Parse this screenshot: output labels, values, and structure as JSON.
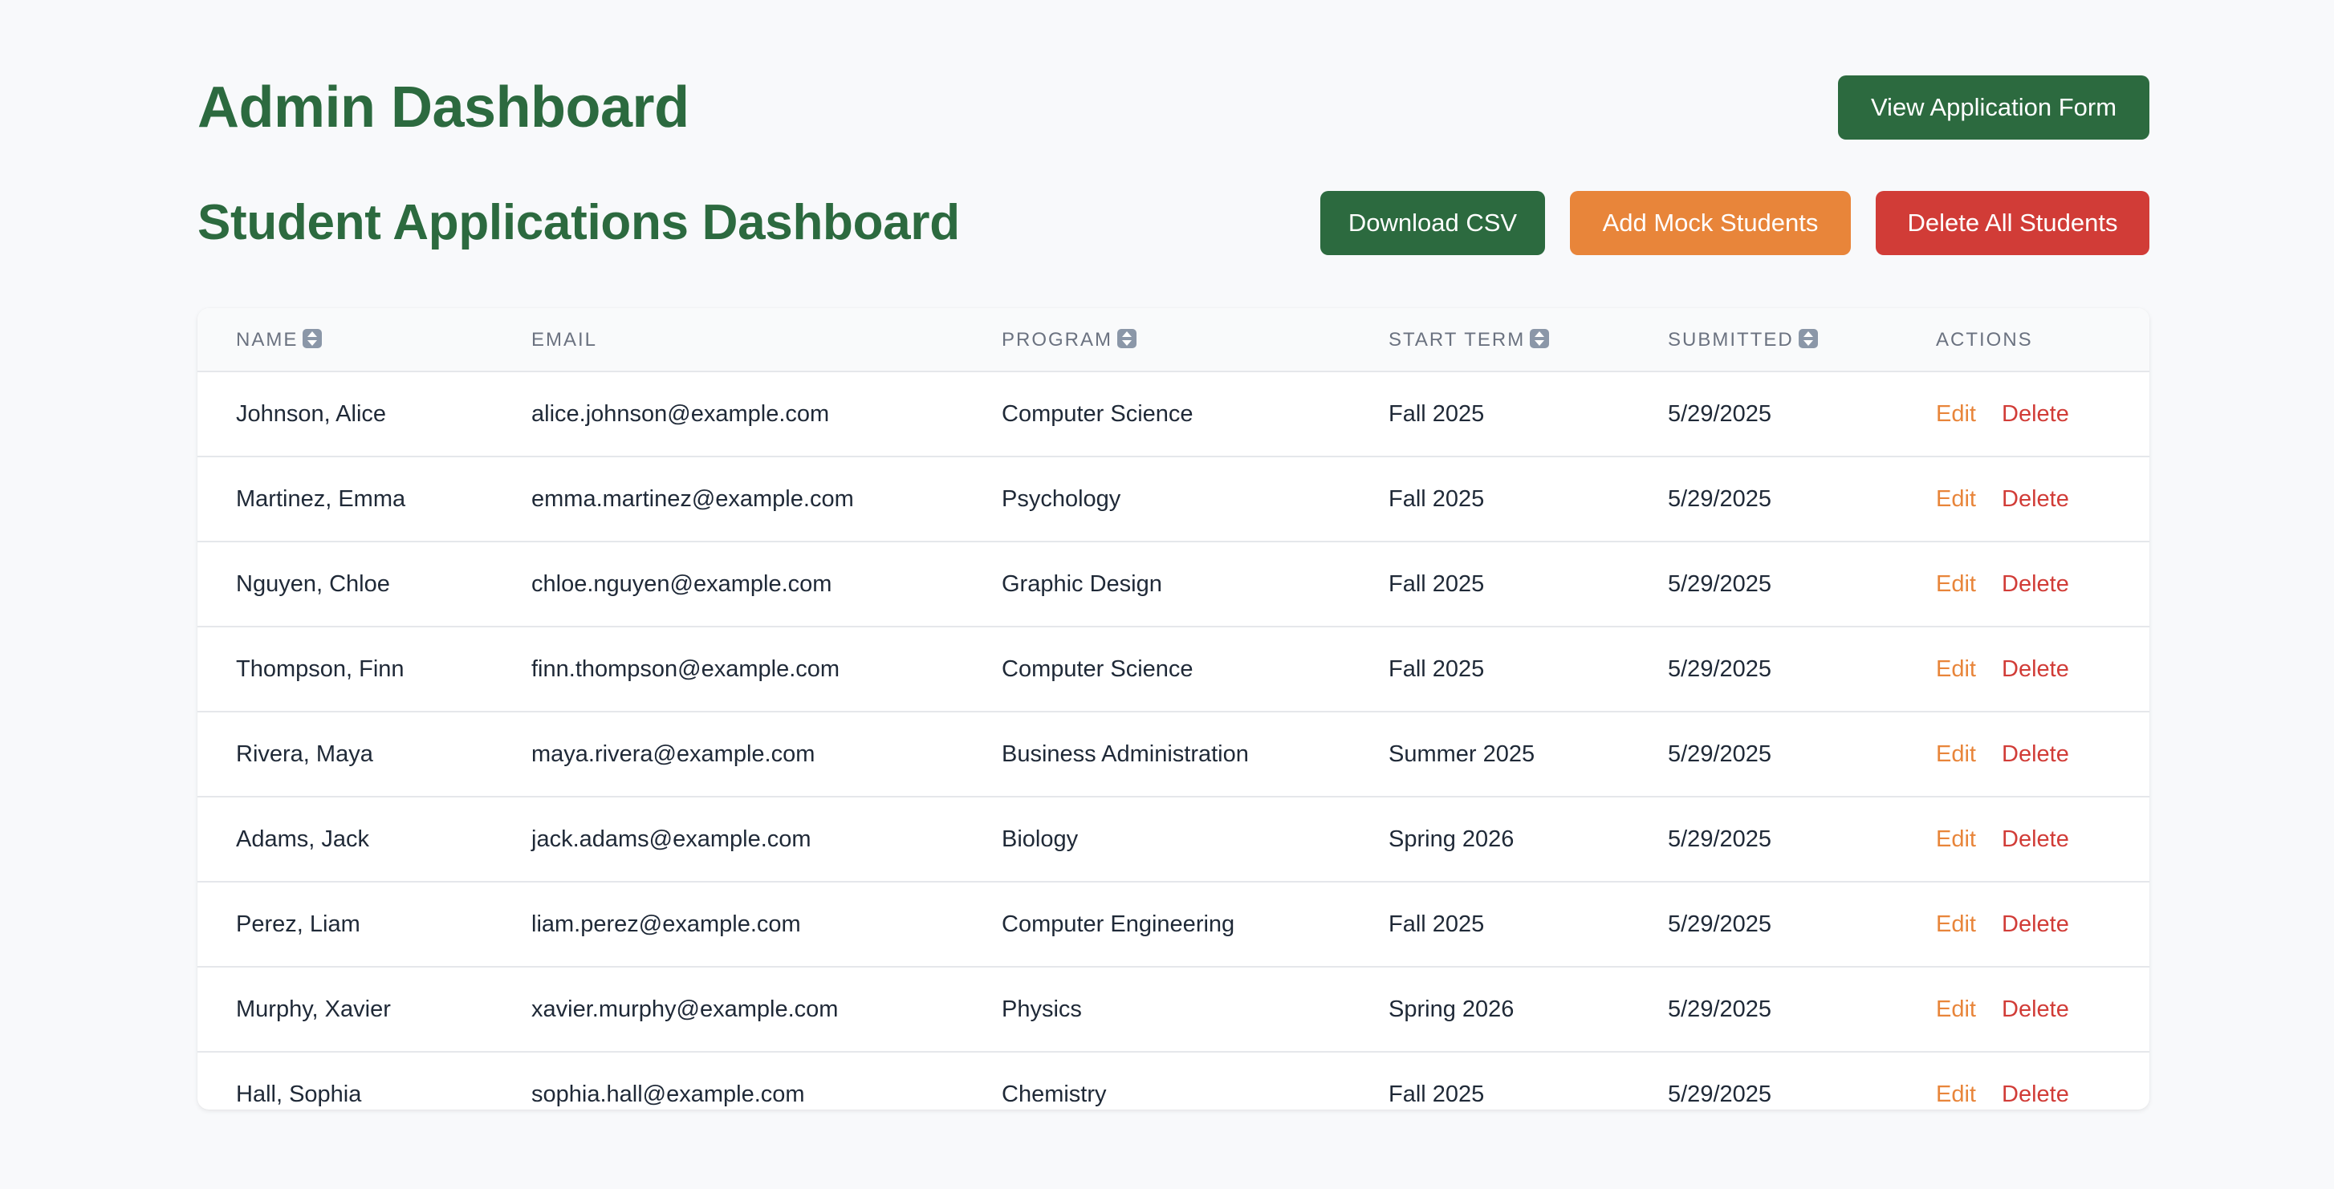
{
  "header": {
    "title": "Admin Dashboard",
    "view_form_label": "View Application Form"
  },
  "dashboard": {
    "title": "Student Applications Dashboard",
    "download_csv_label": "Download CSV",
    "add_mock_label": "Add Mock Students",
    "delete_all_label": "Delete All Students"
  },
  "colors": {
    "primary_green": "#2c6a3f",
    "accent_orange": "#e8853a",
    "danger_red": "#d13c37"
  },
  "table": {
    "columns": [
      {
        "label": "NAME",
        "sortable": true,
        "icon": "sort-icon"
      },
      {
        "label": "EMAIL",
        "sortable": false
      },
      {
        "label": "PROGRAM",
        "sortable": true,
        "icon": "sort-icon"
      },
      {
        "label": "START TERM",
        "sortable": true,
        "icon": "sort-icon"
      },
      {
        "label": "SUBMITTED",
        "sortable": true,
        "icon": "sort-icon"
      },
      {
        "label": "ACTIONS",
        "sortable": false
      }
    ],
    "edit_label": "Edit",
    "delete_label": "Delete",
    "rows": [
      {
        "name": "Johnson, Alice",
        "email": "alice.johnson@example.com",
        "program": "Computer Science",
        "term": "Fall 2025",
        "submitted": "5/29/2025"
      },
      {
        "name": "Martinez, Emma",
        "email": "emma.martinez@example.com",
        "program": "Psychology",
        "term": "Fall 2025",
        "submitted": "5/29/2025"
      },
      {
        "name": "Nguyen, Chloe",
        "email": "chloe.nguyen@example.com",
        "program": "Graphic Design",
        "term": "Fall 2025",
        "submitted": "5/29/2025"
      },
      {
        "name": "Thompson, Finn",
        "email": "finn.thompson@example.com",
        "program": "Computer Science",
        "term": "Fall 2025",
        "submitted": "5/29/2025"
      },
      {
        "name": "Rivera, Maya",
        "email": "maya.rivera@example.com",
        "program": "Business Administration",
        "term": "Summer 2025",
        "submitted": "5/29/2025"
      },
      {
        "name": "Adams, Jack",
        "email": "jack.adams@example.com",
        "program": "Biology",
        "term": "Spring 2026",
        "submitted": "5/29/2025"
      },
      {
        "name": "Perez, Liam",
        "email": "liam.perez@example.com",
        "program": "Computer Engineering",
        "term": "Fall 2025",
        "submitted": "5/29/2025"
      },
      {
        "name": "Murphy, Xavier",
        "email": "xavier.murphy@example.com",
        "program": "Physics",
        "term": "Spring 2026",
        "submitted": "5/29/2025"
      },
      {
        "name": "Hall, Sophia",
        "email": "sophia.hall@example.com",
        "program": "Chemistry",
        "term": "Fall 2025",
        "submitted": "5/29/2025"
      }
    ]
  }
}
